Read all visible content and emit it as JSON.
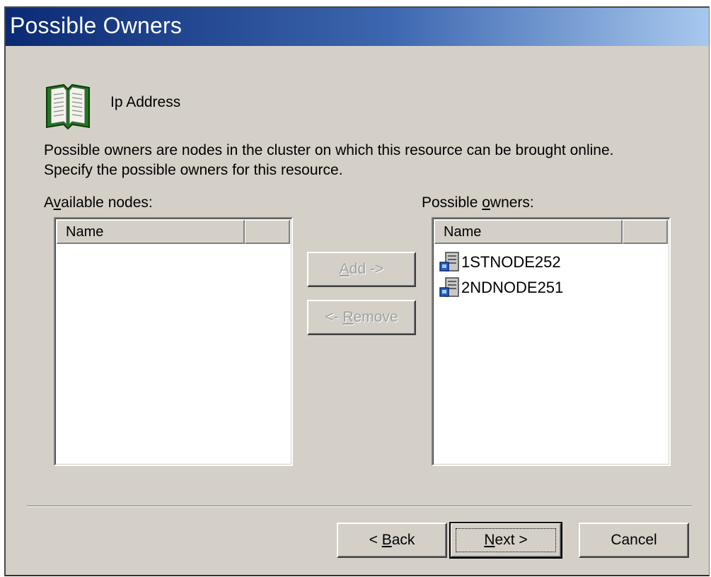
{
  "window": {
    "title": "Possible Owners"
  },
  "resource": {
    "name": "Ip Address",
    "icon": "book-icon"
  },
  "description": {
    "line1": "Possible owners are nodes in the cluster on which this resource can be brought online.",
    "line2": "Specify the possible owners for this resource."
  },
  "available": {
    "label_pre": "A",
    "label_accel": "v",
    "label_post": "ailable nodes:",
    "column_name": "Name",
    "items": []
  },
  "owners": {
    "label_pre": "Possible ",
    "label_accel": "o",
    "label_post": "wners:",
    "column_name": "Name",
    "items": [
      {
        "name": "1STNODE252",
        "icon": "cluster-node-icon"
      },
      {
        "name": "2NDNODE251",
        "icon": "cluster-node-icon"
      }
    ]
  },
  "buttons": {
    "add_accel": "A",
    "add_rest": "dd ->",
    "remove_pre": "<- ",
    "remove_accel": "R",
    "remove_rest": "emove",
    "back_pre": "< ",
    "back_accel": "B",
    "back_rest": "ack",
    "next_accel": "N",
    "next_rest": "ext >",
    "cancel": "Cancel"
  },
  "colors": {
    "face": "#d4d0c8",
    "title_start": "#0b2a73",
    "title_end": "#a7c8ee",
    "disabled_text": "#a0a0a0"
  }
}
